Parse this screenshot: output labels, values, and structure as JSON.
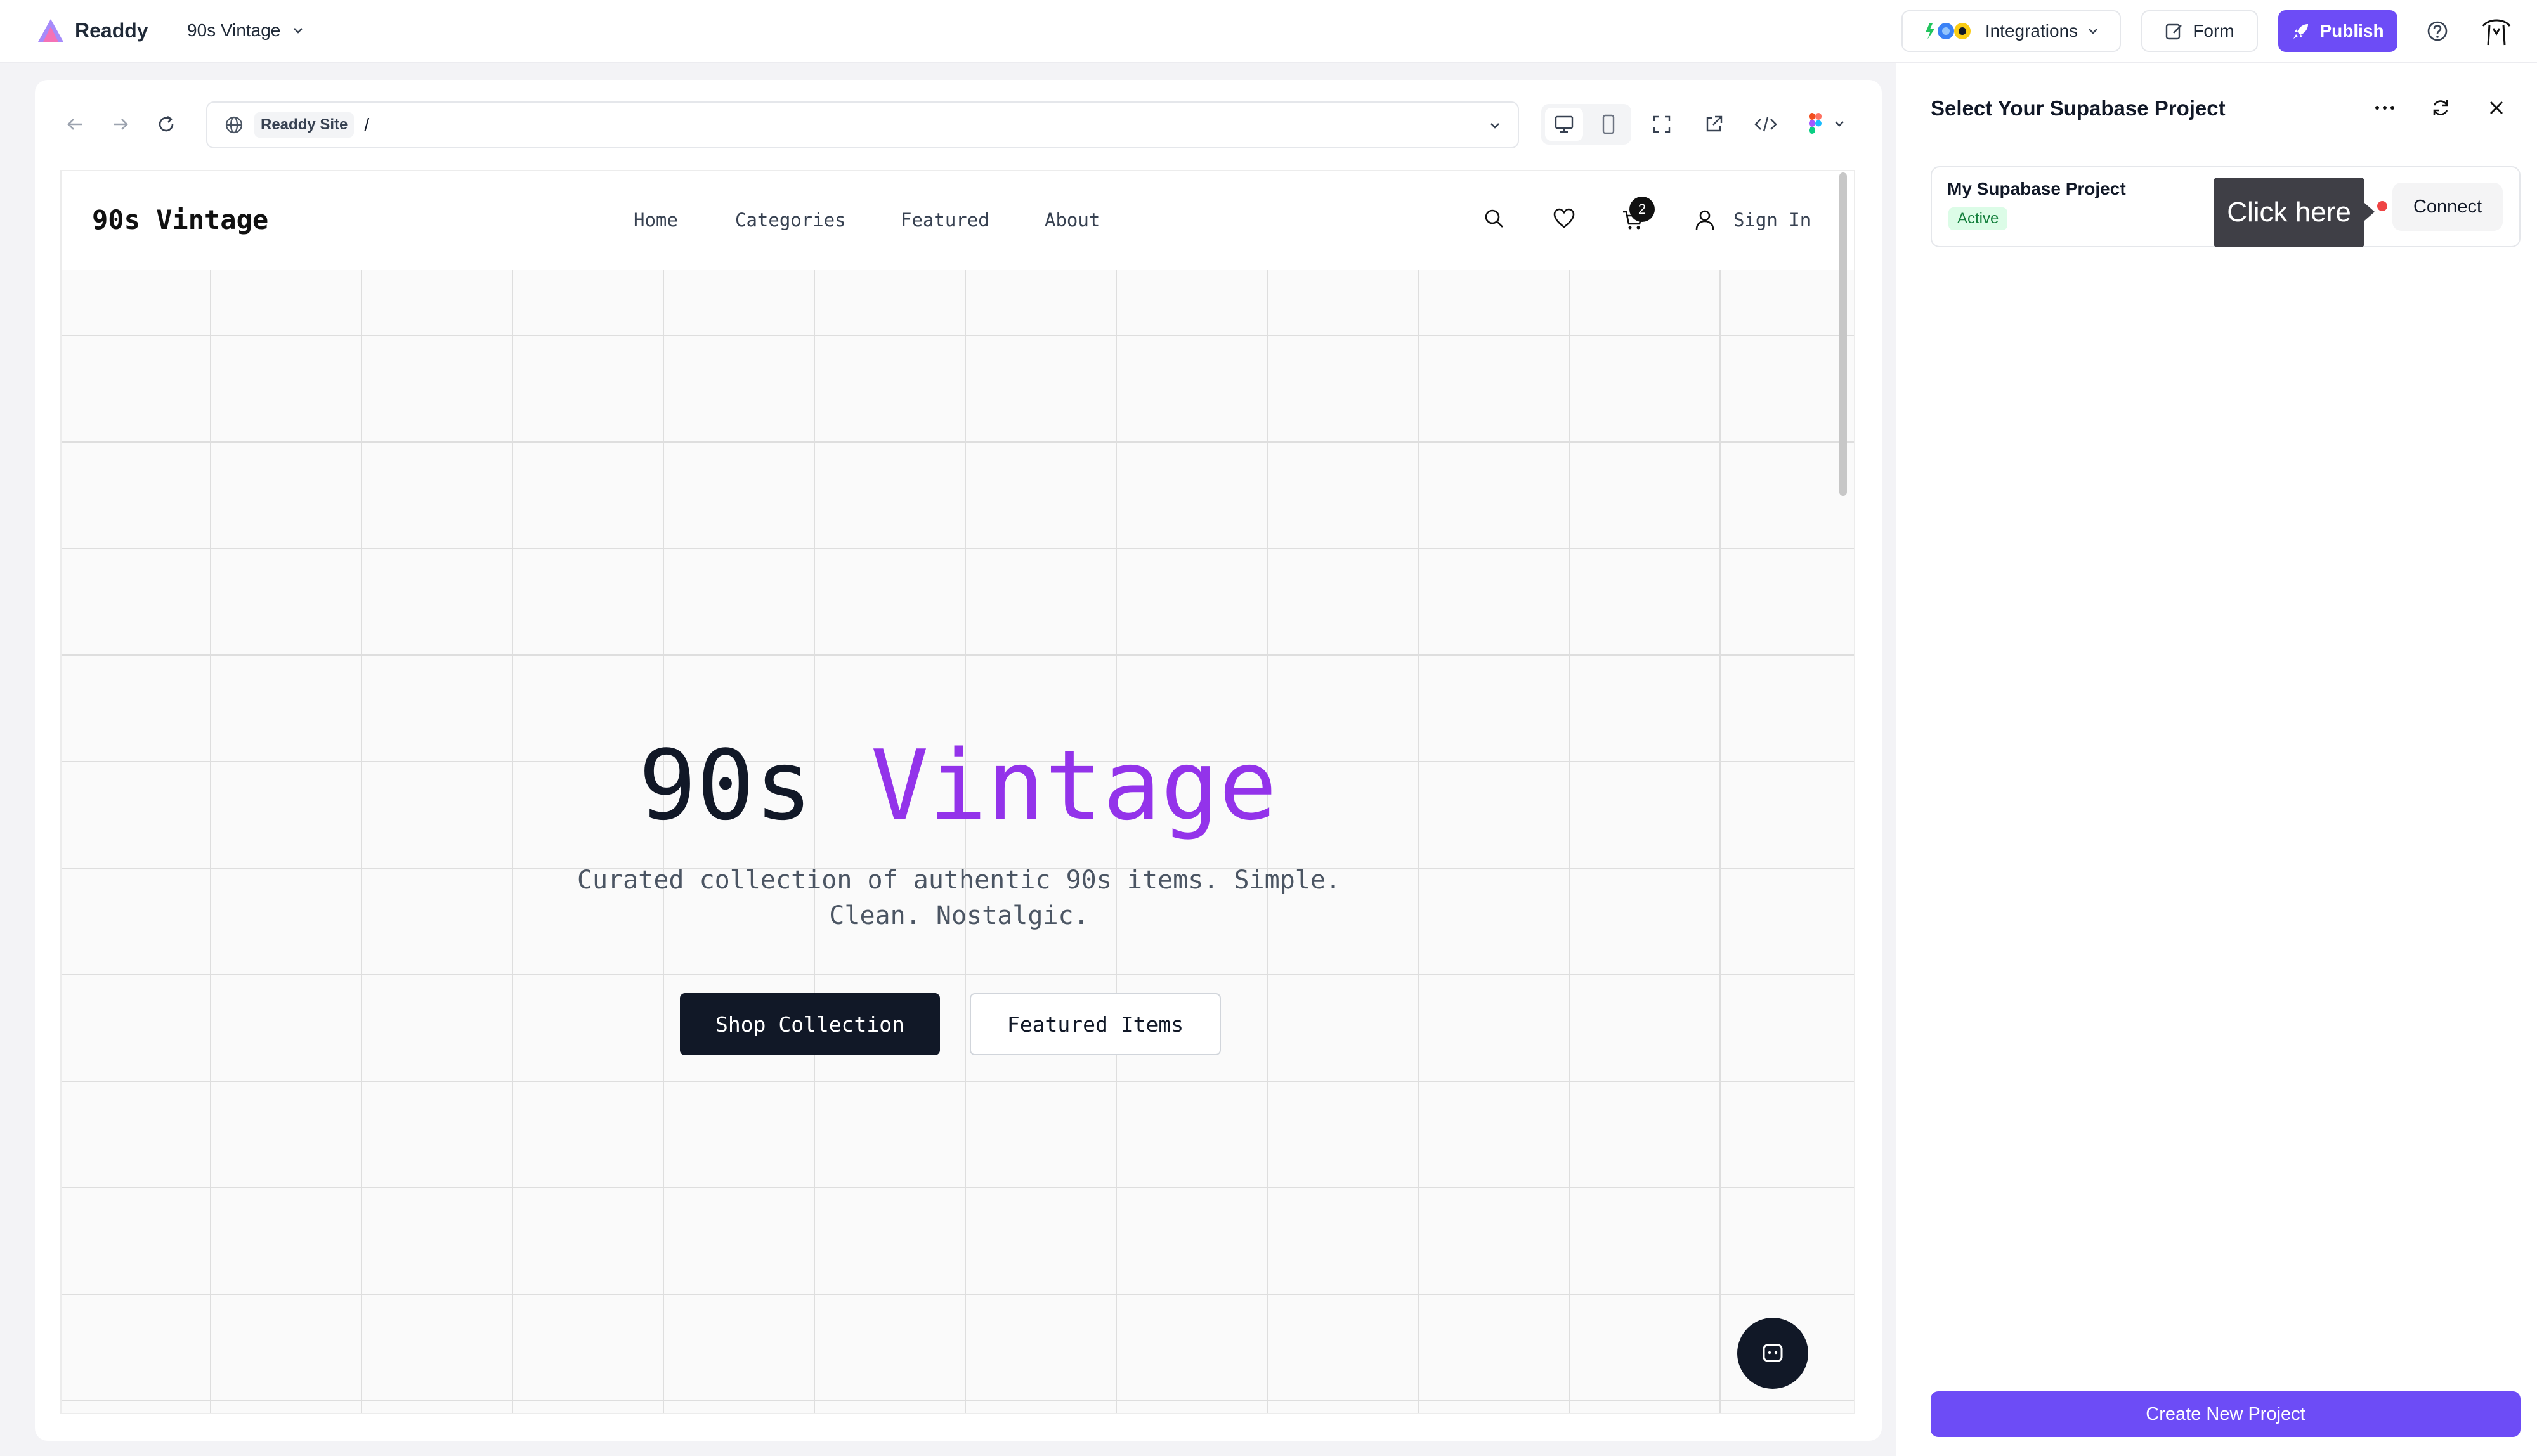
{
  "app": {
    "brand_name": "Readdy",
    "project_name": "90s Vintage"
  },
  "toolbar": {
    "integrations_label": "Integrations",
    "form_label": "Form",
    "publish_label": "Publish"
  },
  "browser": {
    "site_chip": "Readdy Site",
    "path": "/"
  },
  "site": {
    "logo": "90s Vintage",
    "nav": [
      "Home",
      "Categories",
      "Featured",
      "About"
    ],
    "sign_in": "Sign In",
    "cart_count": "2",
    "hero_title_part1": "90s",
    "hero_title_part2": "Vintage",
    "hero_subtitle": "Curated collection of authentic 90s items. Simple. Clean. Nostalgic.",
    "primary_cta": "Shop Collection",
    "secondary_cta": "Featured Items"
  },
  "panel": {
    "title": "Select Your Supabase Project",
    "project_name": "My Supabase Project",
    "project_status": "Active",
    "tooltip": "Click here",
    "connect_label": "Connect",
    "create_label": "Create New Project"
  },
  "colors": {
    "brand_purple": "#6d4cf6",
    "hero_accent": "#9333ea",
    "dark_button": "#111827",
    "active_badge": "#15803d"
  }
}
